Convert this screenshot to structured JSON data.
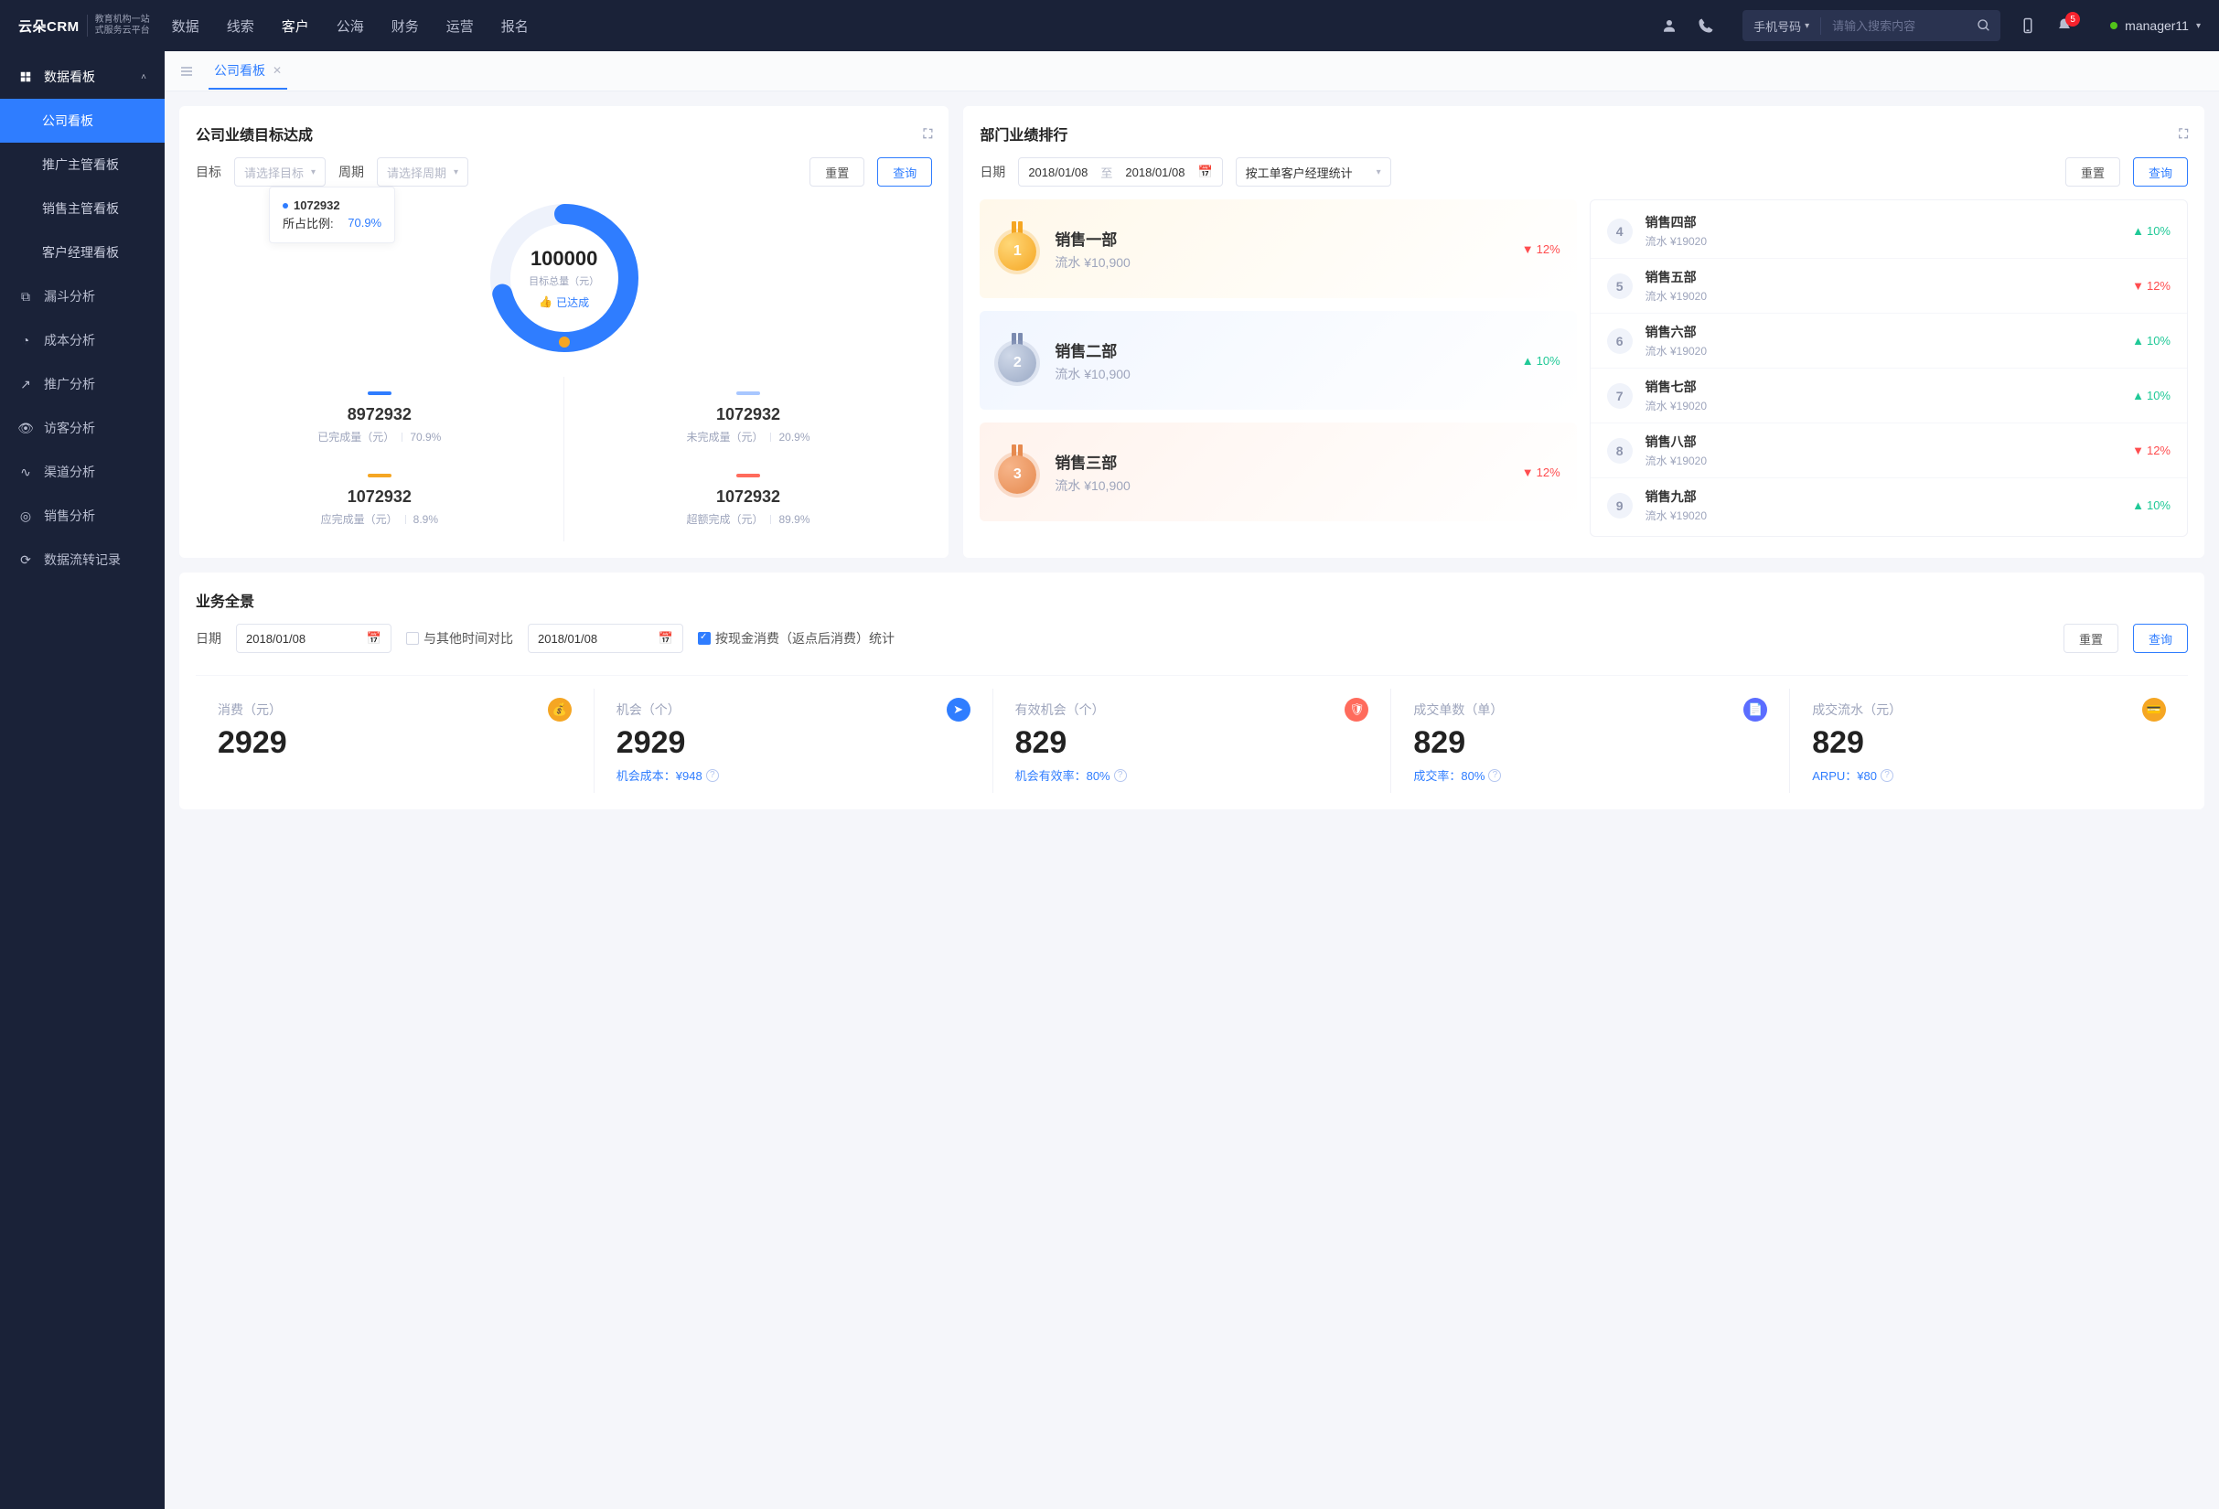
{
  "topnav": {
    "logo_main": "云朵CRM",
    "logo_sub1": "教育机构一站",
    "logo_sub2": "式服务云平台",
    "items": [
      "数据",
      "线索",
      "客户",
      "公海",
      "财务",
      "运营",
      "报名"
    ],
    "active_index": 2,
    "search_type": "手机号码",
    "search_placeholder": "请输入搜索内容",
    "noti_count": "5",
    "user": "manager11"
  },
  "sidebar": {
    "group": "数据看板",
    "subs": [
      "公司看板",
      "推广主管看板",
      "销售主管看板",
      "客户经理看板"
    ],
    "sub_active": 0,
    "items": [
      "漏斗分析",
      "成本分析",
      "推广分析",
      "访客分析",
      "渠道分析",
      "销售分析",
      "数据流转记录"
    ]
  },
  "tab": {
    "label": "公司看板"
  },
  "target_card": {
    "title": "公司业绩目标达成",
    "filter_target": "目标",
    "filter_target_ph": "请选择目标",
    "filter_period": "周期",
    "filter_period_ph": "请选择周期",
    "btn_reset": "重置",
    "btn_query": "查询",
    "tooltip_val": "1072932",
    "tooltip_pct_label": "所占比例:",
    "tooltip_pct": "70.9%",
    "center_value": "100000",
    "center_label": "目标总量（元）",
    "center_badge": "已达成",
    "stats": [
      {
        "bar": "#2f7dff",
        "val": "8972932",
        "label": "已完成量（元）",
        "pct": "70.9%"
      },
      {
        "bar": "#a8c7ff",
        "val": "1072932",
        "label": "未完成量（元）",
        "pct": "20.9%"
      },
      {
        "bar": "#f5a623",
        "val": "1072932",
        "label": "应完成量（元）",
        "pct": "8.9%"
      },
      {
        "bar": "#ff6b5c",
        "val": "1072932",
        "label": "超额完成（元）",
        "pct": "89.9%"
      }
    ]
  },
  "rank_card": {
    "title": "部门业绩排行",
    "filter_date_label": "日期",
    "date_from": "2018/01/08",
    "date_sep": "至",
    "date_to": "2018/01/08",
    "stat_by": "按工单客户经理统计",
    "btn_reset": "重置",
    "btn_query": "查询",
    "top3": [
      {
        "name": "销售一部",
        "flow": "流水 ¥10,900",
        "delta": "12%",
        "dir": "down"
      },
      {
        "name": "销售二部",
        "flow": "流水 ¥10,900",
        "delta": "10%",
        "dir": "up"
      },
      {
        "name": "销售三部",
        "flow": "流水 ¥10,900",
        "delta": "12%",
        "dir": "down"
      }
    ],
    "rest": [
      {
        "rank": "4",
        "name": "销售四部",
        "flow": "流水 ¥19020",
        "delta": "10%",
        "dir": "up"
      },
      {
        "rank": "5",
        "name": "销售五部",
        "flow": "流水 ¥19020",
        "delta": "12%",
        "dir": "down"
      },
      {
        "rank": "6",
        "name": "销售六部",
        "flow": "流水 ¥19020",
        "delta": "10%",
        "dir": "up"
      },
      {
        "rank": "7",
        "name": "销售七部",
        "flow": "流水 ¥19020",
        "delta": "10%",
        "dir": "up"
      },
      {
        "rank": "8",
        "name": "销售八部",
        "flow": "流水 ¥19020",
        "delta": "12%",
        "dir": "down"
      },
      {
        "rank": "9",
        "name": "销售九部",
        "flow": "流水 ¥19020",
        "delta": "10%",
        "dir": "up"
      }
    ]
  },
  "overview": {
    "title": "业务全景",
    "filter_date_label": "日期",
    "date1": "2018/01/08",
    "compare_label": "与其他时间对比",
    "date2": "2018/01/08",
    "check_label": "按现金消费（返点后消费）统计",
    "btn_reset": "重置",
    "btn_query": "查询",
    "kpis": [
      {
        "name": "消费（元）",
        "value": "2929",
        "icon": "#f5a623",
        "sub": ""
      },
      {
        "name": "机会（个）",
        "value": "2929",
        "icon": "#2f7dff",
        "sub": "机会成本：¥948"
      },
      {
        "name": "有效机会（个）",
        "value": "829",
        "icon": "#ff6b5c",
        "sub": "机会有效率：80%"
      },
      {
        "name": "成交单数（单）",
        "value": "829",
        "icon": "#5b6dff",
        "sub": "成交率：80%"
      },
      {
        "name": "成交流水（元）",
        "value": "829",
        "icon": "#f5a623",
        "sub": "ARPU：¥80"
      }
    ]
  },
  "chart_data": {
    "type": "pie",
    "title": "公司业绩目标达成",
    "total_label": "目标总量（元）",
    "total": 100000,
    "series": [
      {
        "name": "已完成量（元）",
        "value": 8972932,
        "pct": 70.9,
        "color": "#2f7dff"
      },
      {
        "name": "未完成量（元）",
        "value": 1072932,
        "pct": 20.9,
        "color": "#a8c7ff"
      },
      {
        "name": "应完成量（元）",
        "value": 1072932,
        "pct": 8.9,
        "color": "#f5a623"
      },
      {
        "name": "超额完成（元）",
        "value": 1072932,
        "pct": 89.9,
        "color": "#ff6b5c"
      }
    ],
    "highlighted": {
      "value": 1072932,
      "pct": 70.9
    }
  }
}
